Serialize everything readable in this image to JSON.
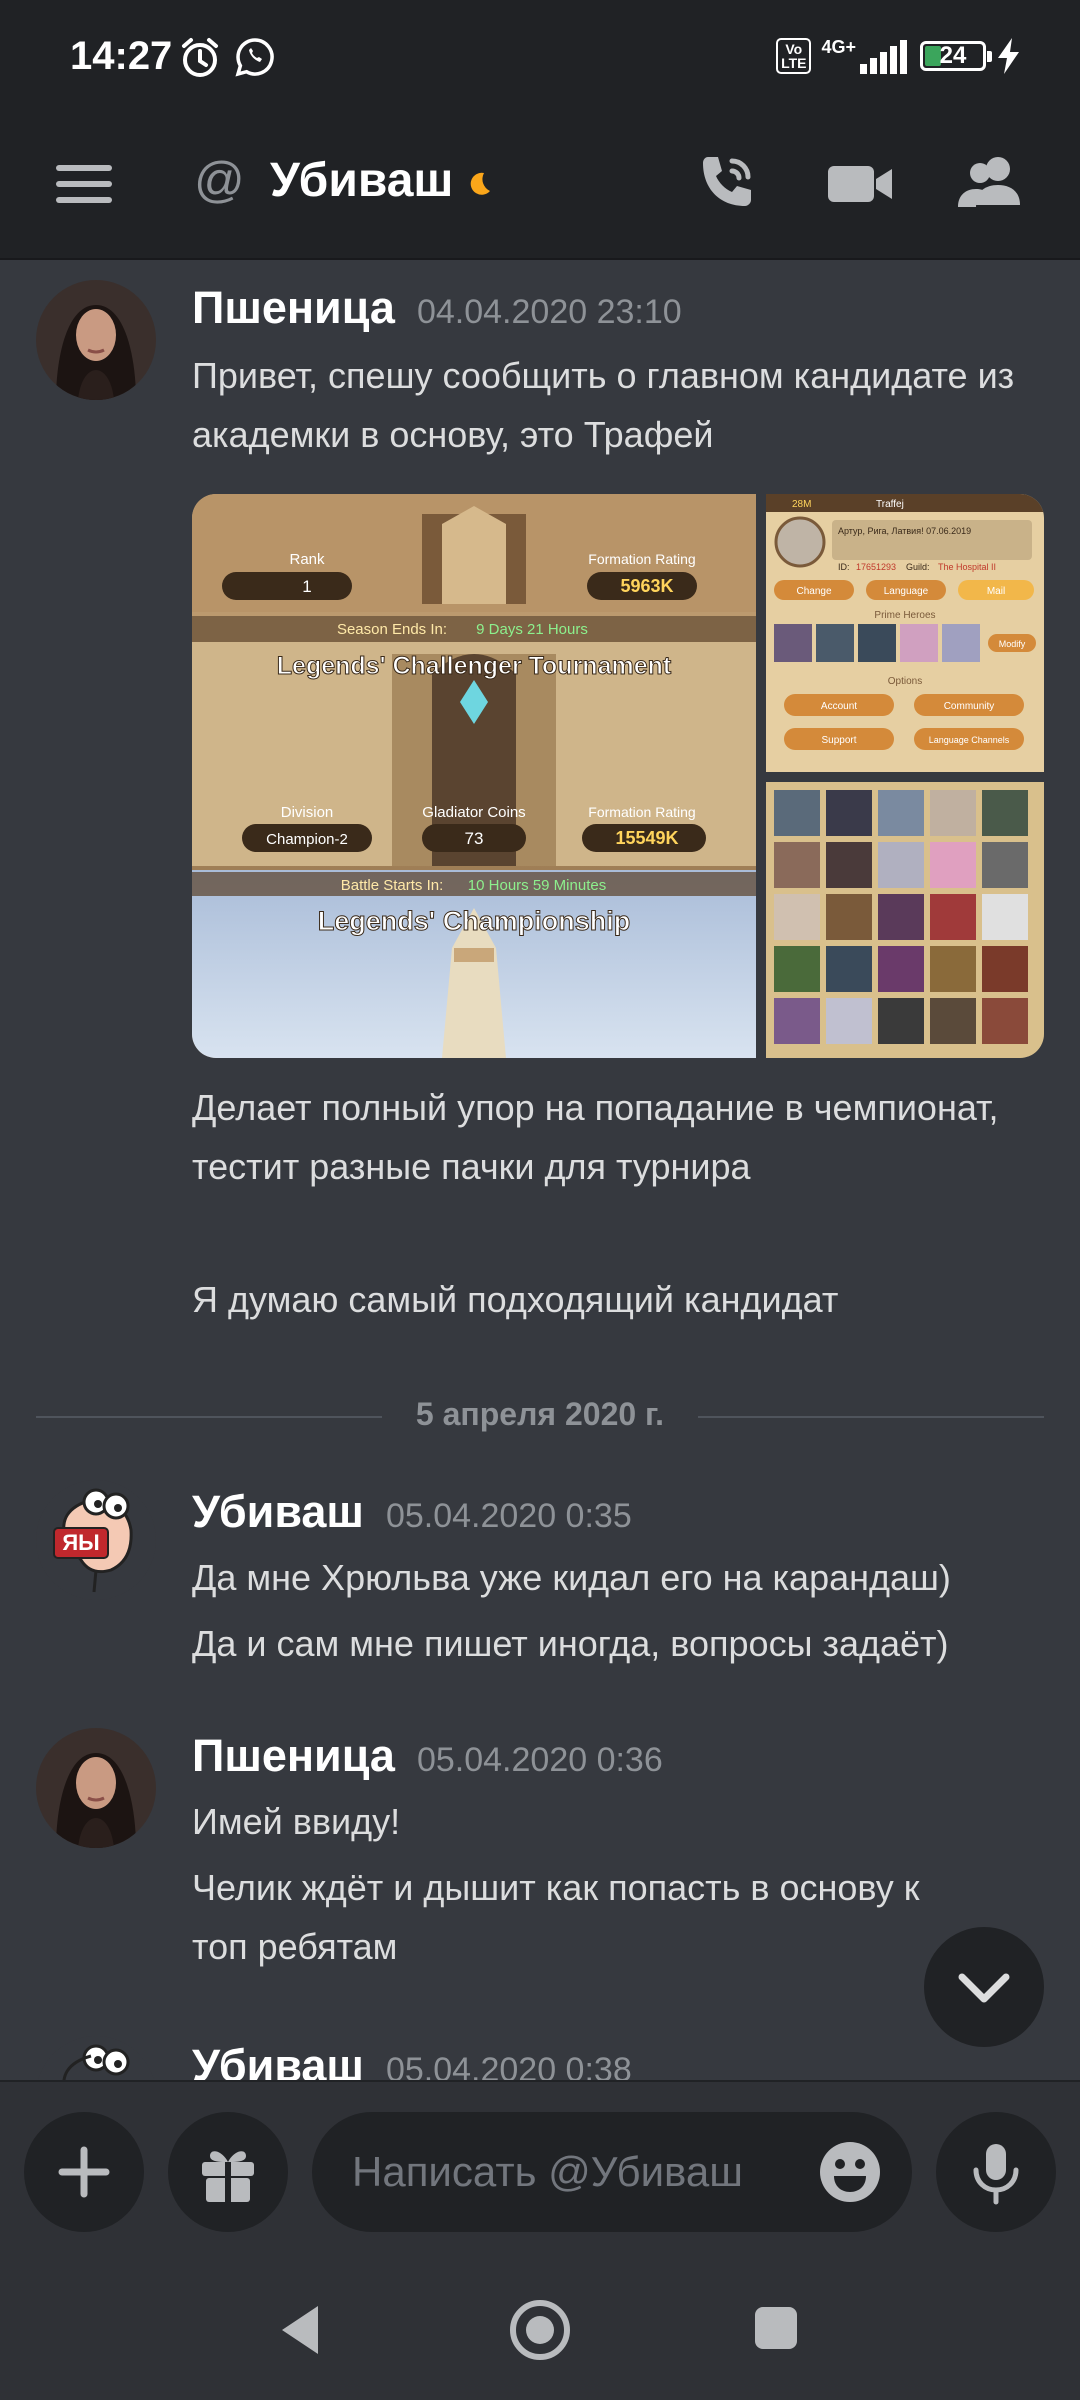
{
  "status_bar": {
    "time": "14:27",
    "network_badge": "Vo LTE",
    "network_type": "4G+",
    "battery": "24"
  },
  "header": {
    "channel_prefix": "@",
    "title": "Убиваш",
    "icons": [
      "menu-icon",
      "call-icon",
      "video-icon",
      "members-icon"
    ]
  },
  "messages": [
    {
      "author": "Пшеница",
      "timestamp": "04.04.2020 23:10",
      "lines": [
        "Привет, спешу сообщить о главном кандидате из академки в основу, это Трафей",
        "Делает полный упор на попадание в чемпионат, тестит разные пачки для турнира",
        "Я думаю самый подходящий кандидат"
      ],
      "attachment": {
        "rank_label": "Rank",
        "rank_value": "1",
        "formation_label": "Formation Rating",
        "formation_value": "5963K",
        "season_text": "Season Ends In:",
        "season_value": "9 Days 21 Hours",
        "tournament_title": "Legends' Challenger Tournament",
        "division_label": "Division",
        "division_value": "Champion-2",
        "coins_label": "Gladiator Coins",
        "coins_value": "73",
        "formation_label_2": "Formation Rating",
        "formation_value_2": "15549K",
        "battle_text": "Battle Starts In:",
        "battle_value": "10 Hours 59 Minutes",
        "championship_title": "Legends' Championship",
        "profile": {
          "vip": "28M",
          "name": "Traffej",
          "location": "Артур, Рига, Латвия! 07.06.2019",
          "id_label": "ID:",
          "id_value": "17651293",
          "guild_label": "Guild:",
          "guild_value": "The Hospital II",
          "buttons": [
            "Change",
            "Language",
            "Mail"
          ],
          "prime_heroes": "Prime Heroes",
          "modify": "Modify",
          "options": "Options",
          "option_buttons": [
            "Account",
            "Community",
            "Support",
            "Language Channels"
          ]
        }
      }
    },
    {
      "author": "Убиваш",
      "timestamp": "05.04.2020 0:35",
      "lines": [
        "Да мне Хрюльва уже кидал его на карандаш)",
        "Да и сам мне пишет иногда, вопросы задаёт)"
      ]
    },
    {
      "author": "Пшеница",
      "timestamp": "05.04.2020 0:36",
      "lines": [
        "Имей ввиду!",
        "Челик ждёт и дышит как попасть в основу к топ ребятам"
      ]
    },
    {
      "author": "Убиваш",
      "timestamp": "05.04.2020 0:38",
      "lines": []
    }
  ],
  "date_divider": "5 апреля 2020 г.",
  "composer": {
    "placeholder": "Написать @Убиваш"
  },
  "colors": {
    "background": "#36393f",
    "header_bg": "#202225",
    "text": "#dcddde",
    "muted": "#8e9297",
    "idle_moon": "#faa61a"
  }
}
